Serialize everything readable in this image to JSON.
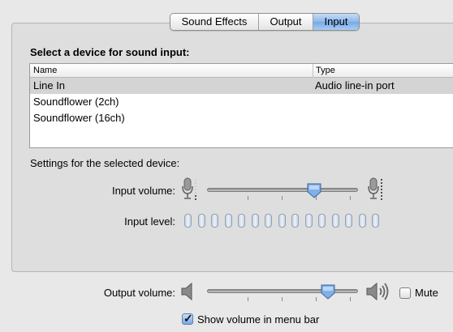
{
  "tabs": [
    "Sound Effects",
    "Output",
    "Input"
  ],
  "active_tab": "Input",
  "heading": "Select a device for sound input:",
  "table": {
    "columns": [
      "Name",
      "Type"
    ],
    "rows": [
      {
        "name": "Line In",
        "type": "Audio line-in port",
        "selected": true
      },
      {
        "name": "Soundflower (2ch)",
        "type": ""
      },
      {
        "name": "Soundflower (16ch)",
        "type": ""
      }
    ]
  },
  "settings_label": "Settings for the selected device:",
  "input_volume": {
    "label": "Input volume:",
    "level": 0.71
  },
  "input_level": {
    "label": "Input level:",
    "segments": 15,
    "lit": 0
  },
  "output_volume": {
    "label": "Output volume:",
    "level": 0.8
  },
  "mute": {
    "label": "Mute",
    "checked": false
  },
  "show_volume": {
    "label": "Show volume in menu bar",
    "checked": true
  },
  "colors": {
    "selected_tab": "#8db7ea",
    "selected_row": "#d4d4d4",
    "window_bg": "#e8e8e8"
  }
}
